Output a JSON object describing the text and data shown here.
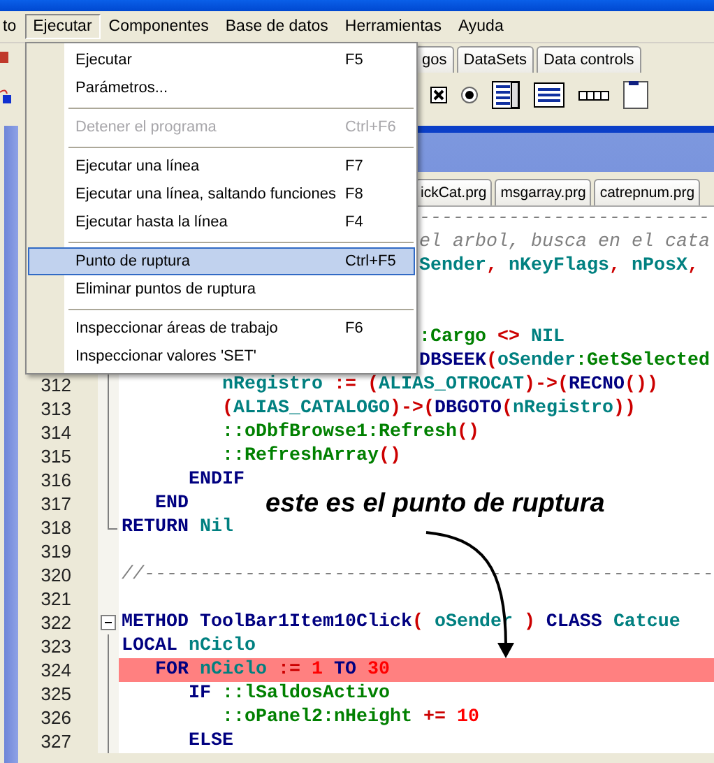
{
  "menu_bar": {
    "items": [
      {
        "label": "to",
        "selected": false
      },
      {
        "label": "Ejecutar",
        "selected": true
      },
      {
        "label": "Componentes",
        "selected": false
      },
      {
        "label": "Base de datos",
        "selected": false
      },
      {
        "label": "Herramientas",
        "selected": false
      },
      {
        "label": "Ayuda",
        "selected": false
      }
    ]
  },
  "palette_tabs": [
    {
      "label": "gos"
    },
    {
      "label": "DataSets"
    },
    {
      "label": "Data controls"
    }
  ],
  "menu": {
    "items": [
      {
        "kind": "item",
        "label": "Ejecutar",
        "shortcut": "F5",
        "disabled": false,
        "selected": false
      },
      {
        "kind": "item",
        "label": "Parámetros...",
        "disabled": false,
        "selected": false
      },
      {
        "kind": "separator"
      },
      {
        "kind": "item",
        "label": "Detener el programa",
        "shortcut": "Ctrl+F6",
        "disabled": true,
        "selected": false
      },
      {
        "kind": "separator"
      },
      {
        "kind": "item",
        "label": "Ejecutar una línea",
        "shortcut": "F7",
        "disabled": false,
        "selected": false
      },
      {
        "kind": "item",
        "label": "Ejecutar una línea, saltando funciones",
        "shortcut": "F8",
        "disabled": false,
        "selected": false
      },
      {
        "kind": "item",
        "label": "Ejecutar hasta la línea",
        "shortcut": "F4",
        "disabled": false,
        "selected": false
      },
      {
        "kind": "separator"
      },
      {
        "kind": "item",
        "label": "Punto de ruptura",
        "shortcut": "Ctrl+F5",
        "disabled": false,
        "selected": true
      },
      {
        "kind": "item",
        "label": "Eliminar puntos de ruptura",
        "disabled": false,
        "selected": false
      },
      {
        "kind": "separator"
      },
      {
        "kind": "item",
        "label": "Inspeccionar áreas de trabajo",
        "shortcut": "F6",
        "disabled": false,
        "selected": false
      },
      {
        "kind": "item",
        "label": "Inspeccionar valores 'SET'",
        "disabled": false,
        "selected": false
      }
    ]
  },
  "editor_tabs": [
    {
      "label": "ickCat.prg"
    },
    {
      "label": "msgarray.prg"
    },
    {
      "label": "catrepnum.prg"
    }
  ],
  "editor": {
    "lines": [
      {
        "kind": "covered",
        "tokens": [
          {
            "kind": "comment",
            "text": "--------------------------"
          }
        ]
      },
      {
        "kind": "covered",
        "tokens": [
          {
            "kind": "comment",
            "text": "el arbol, busca en el cata"
          }
        ]
      },
      {
        "kind": "covered",
        "tokens": [
          {
            "kind": "ident",
            "text": "Sender"
          },
          {
            "kind": "op",
            "text": ", "
          },
          {
            "kind": "ident",
            "text": "nKeyFlags"
          },
          {
            "kind": "op",
            "text": ", "
          },
          {
            "kind": "ident",
            "text": "nPosX"
          },
          {
            "kind": "op",
            "text": ","
          }
        ]
      },
      {
        "kind": "covered"
      },
      {
        "kind": "covered"
      },
      {
        "kind": "covered",
        "tokens": [
          {
            "kind": "method",
            "text": ":Cargo"
          },
          {
            "kind": "op",
            "text": " <> "
          },
          {
            "kind": "ident",
            "text": "NIL"
          }
        ]
      },
      {
        "kind": "covered",
        "tokens": [
          {
            "kind": "keyword",
            "text": "DBSEEK"
          },
          {
            "kind": "op",
            "text": "("
          },
          {
            "kind": "ident",
            "text": "oSender"
          },
          {
            "kind": "method",
            "text": ":GetSelected"
          }
        ]
      },
      {
        "kind": "code",
        "number": "312",
        "fold": {
          "kind": "line"
        },
        "breakpoint": false,
        "tokens": [
          {
            "kind": "ident",
            "text": "         nRegistro"
          },
          {
            "kind": "op",
            "text": " := ("
          },
          {
            "kind": "ident",
            "text": "ALIAS_OTROCAT"
          },
          {
            "kind": "op",
            "text": ")->("
          },
          {
            "kind": "keyword",
            "text": "RECNO"
          },
          {
            "kind": "op",
            "text": "())"
          }
        ]
      },
      {
        "kind": "code",
        "number": "313",
        "fold": {
          "kind": "line"
        },
        "breakpoint": false,
        "tokens": [
          {
            "kind": "op",
            "text": "         ("
          },
          {
            "kind": "ident",
            "text": "ALIAS_CATALOGO"
          },
          {
            "kind": "op",
            "text": ")->("
          },
          {
            "kind": "keyword",
            "text": "DBGOTO"
          },
          {
            "kind": "op",
            "text": "("
          },
          {
            "kind": "ident",
            "text": "nRegistro"
          },
          {
            "kind": "op",
            "text": "))"
          }
        ]
      },
      {
        "kind": "code",
        "number": "314",
        "fold": {
          "kind": "line"
        },
        "breakpoint": false,
        "tokens": [
          {
            "kind": "method",
            "text": "         ::oDbfBrowse1:Refresh"
          },
          {
            "kind": "op",
            "text": "()"
          }
        ]
      },
      {
        "kind": "code",
        "number": "315",
        "fold": {
          "kind": "line"
        },
        "breakpoint": false,
        "tokens": [
          {
            "kind": "method",
            "text": "         ::RefreshArray"
          },
          {
            "kind": "op",
            "text": "()"
          }
        ]
      },
      {
        "kind": "code",
        "number": "316",
        "fold": {
          "kind": "line"
        },
        "breakpoint": false,
        "tokens": [
          {
            "kind": "keyword",
            "text": "      ENDIF"
          }
        ]
      },
      {
        "kind": "code",
        "number": "317",
        "fold": {
          "kind": "line"
        },
        "breakpoint": false,
        "tokens": [
          {
            "kind": "keyword",
            "text": "   END"
          }
        ]
      },
      {
        "kind": "code",
        "number": "318",
        "fold": {
          "kind": "end"
        },
        "breakpoint": false,
        "tokens": [
          {
            "kind": "keyword",
            "text": "RETURN"
          },
          {
            "kind": "ident",
            "text": " Nil"
          }
        ]
      },
      {
        "kind": "code",
        "number": "319",
        "breakpoint": false
      },
      {
        "kind": "code",
        "number": "320",
        "breakpoint": false,
        "tokens": [
          {
            "kind": "comment",
            "text": "//---------------------------------------------------"
          }
        ]
      },
      {
        "kind": "code",
        "number": "321",
        "breakpoint": false
      },
      {
        "kind": "code",
        "number": "322",
        "fold": {
          "kind": "start"
        },
        "breakpoint": false,
        "tokens": [
          {
            "kind": "keyword",
            "text": "METHOD ToolBar1Item10Click"
          },
          {
            "kind": "op",
            "text": "("
          },
          {
            "kind": "ident",
            "text": " oSender "
          },
          {
            "kind": "op",
            "text": ")"
          },
          {
            "kind": "keyword",
            "text": " CLASS "
          },
          {
            "kind": "ident",
            "text": "Catcue"
          }
        ]
      },
      {
        "kind": "code",
        "number": "323",
        "fold": {
          "kind": "line"
        },
        "breakpoint": false,
        "tokens": [
          {
            "kind": "keyword",
            "text": "LOCAL"
          },
          {
            "kind": "ident",
            "text": " nCiclo"
          }
        ]
      },
      {
        "kind": "code",
        "number": "324",
        "fold": {
          "kind": "line"
        },
        "breakpoint": true,
        "tokens": [
          {
            "kind": "keyword",
            "text": "   FOR"
          },
          {
            "kind": "ident",
            "text": " nCiclo"
          },
          {
            "kind": "op",
            "text": " := "
          },
          {
            "kind": "number",
            "text": "1"
          },
          {
            "kind": "keyword",
            "text": " TO "
          },
          {
            "kind": "number",
            "text": "30"
          }
        ]
      },
      {
        "kind": "code",
        "number": "325",
        "fold": {
          "kind": "line"
        },
        "breakpoint": false,
        "tokens": [
          {
            "kind": "keyword",
            "text": "      IF"
          },
          {
            "kind": "method",
            "text": " ::lSaldosActivo"
          }
        ]
      },
      {
        "kind": "code",
        "number": "326",
        "fold": {
          "kind": "line"
        },
        "breakpoint": false,
        "tokens": [
          {
            "kind": "method",
            "text": "         ::oPanel2:nHeight"
          },
          {
            "kind": "op",
            "text": " += "
          },
          {
            "kind": "number",
            "text": "10"
          }
        ]
      },
      {
        "kind": "code",
        "number": "327",
        "fold": {
          "kind": "line"
        },
        "breakpoint": false,
        "tokens": [
          {
            "kind": "keyword",
            "text": "      ELSE"
          }
        ]
      }
    ]
  },
  "annotation": {
    "text": "este es el punto de ruptura"
  }
}
